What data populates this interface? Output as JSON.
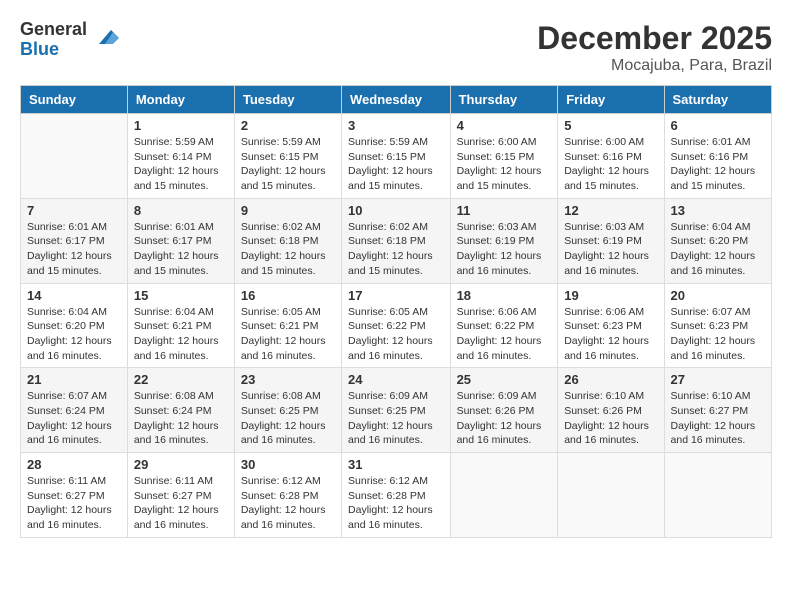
{
  "logo": {
    "general": "General",
    "blue": "Blue"
  },
  "title": "December 2025",
  "location": "Mocajuba, Para, Brazil",
  "weekdays": [
    "Sunday",
    "Monday",
    "Tuesday",
    "Wednesday",
    "Thursday",
    "Friday",
    "Saturday"
  ],
  "weeks": [
    [
      {
        "day": "",
        "info": ""
      },
      {
        "day": "1",
        "info": "Sunrise: 5:59 AM\nSunset: 6:14 PM\nDaylight: 12 hours\nand 15 minutes."
      },
      {
        "day": "2",
        "info": "Sunrise: 5:59 AM\nSunset: 6:15 PM\nDaylight: 12 hours\nand 15 minutes."
      },
      {
        "day": "3",
        "info": "Sunrise: 5:59 AM\nSunset: 6:15 PM\nDaylight: 12 hours\nand 15 minutes."
      },
      {
        "day": "4",
        "info": "Sunrise: 6:00 AM\nSunset: 6:15 PM\nDaylight: 12 hours\nand 15 minutes."
      },
      {
        "day": "5",
        "info": "Sunrise: 6:00 AM\nSunset: 6:16 PM\nDaylight: 12 hours\nand 15 minutes."
      },
      {
        "day": "6",
        "info": "Sunrise: 6:01 AM\nSunset: 6:16 PM\nDaylight: 12 hours\nand 15 minutes."
      }
    ],
    [
      {
        "day": "7",
        "info": "Sunrise: 6:01 AM\nSunset: 6:17 PM\nDaylight: 12 hours\nand 15 minutes."
      },
      {
        "day": "8",
        "info": "Sunrise: 6:01 AM\nSunset: 6:17 PM\nDaylight: 12 hours\nand 15 minutes."
      },
      {
        "day": "9",
        "info": "Sunrise: 6:02 AM\nSunset: 6:18 PM\nDaylight: 12 hours\nand 15 minutes."
      },
      {
        "day": "10",
        "info": "Sunrise: 6:02 AM\nSunset: 6:18 PM\nDaylight: 12 hours\nand 15 minutes."
      },
      {
        "day": "11",
        "info": "Sunrise: 6:03 AM\nSunset: 6:19 PM\nDaylight: 12 hours\nand 16 minutes."
      },
      {
        "day": "12",
        "info": "Sunrise: 6:03 AM\nSunset: 6:19 PM\nDaylight: 12 hours\nand 16 minutes."
      },
      {
        "day": "13",
        "info": "Sunrise: 6:04 AM\nSunset: 6:20 PM\nDaylight: 12 hours\nand 16 minutes."
      }
    ],
    [
      {
        "day": "14",
        "info": "Sunrise: 6:04 AM\nSunset: 6:20 PM\nDaylight: 12 hours\nand 16 minutes."
      },
      {
        "day": "15",
        "info": "Sunrise: 6:04 AM\nSunset: 6:21 PM\nDaylight: 12 hours\nand 16 minutes."
      },
      {
        "day": "16",
        "info": "Sunrise: 6:05 AM\nSunset: 6:21 PM\nDaylight: 12 hours\nand 16 minutes."
      },
      {
        "day": "17",
        "info": "Sunrise: 6:05 AM\nSunset: 6:22 PM\nDaylight: 12 hours\nand 16 minutes."
      },
      {
        "day": "18",
        "info": "Sunrise: 6:06 AM\nSunset: 6:22 PM\nDaylight: 12 hours\nand 16 minutes."
      },
      {
        "day": "19",
        "info": "Sunrise: 6:06 AM\nSunset: 6:23 PM\nDaylight: 12 hours\nand 16 minutes."
      },
      {
        "day": "20",
        "info": "Sunrise: 6:07 AM\nSunset: 6:23 PM\nDaylight: 12 hours\nand 16 minutes."
      }
    ],
    [
      {
        "day": "21",
        "info": "Sunrise: 6:07 AM\nSunset: 6:24 PM\nDaylight: 12 hours\nand 16 minutes."
      },
      {
        "day": "22",
        "info": "Sunrise: 6:08 AM\nSunset: 6:24 PM\nDaylight: 12 hours\nand 16 minutes."
      },
      {
        "day": "23",
        "info": "Sunrise: 6:08 AM\nSunset: 6:25 PM\nDaylight: 12 hours\nand 16 minutes."
      },
      {
        "day": "24",
        "info": "Sunrise: 6:09 AM\nSunset: 6:25 PM\nDaylight: 12 hours\nand 16 minutes."
      },
      {
        "day": "25",
        "info": "Sunrise: 6:09 AM\nSunset: 6:26 PM\nDaylight: 12 hours\nand 16 minutes."
      },
      {
        "day": "26",
        "info": "Sunrise: 6:10 AM\nSunset: 6:26 PM\nDaylight: 12 hours\nand 16 minutes."
      },
      {
        "day": "27",
        "info": "Sunrise: 6:10 AM\nSunset: 6:27 PM\nDaylight: 12 hours\nand 16 minutes."
      }
    ],
    [
      {
        "day": "28",
        "info": "Sunrise: 6:11 AM\nSunset: 6:27 PM\nDaylight: 12 hours\nand 16 minutes."
      },
      {
        "day": "29",
        "info": "Sunrise: 6:11 AM\nSunset: 6:27 PM\nDaylight: 12 hours\nand 16 minutes."
      },
      {
        "day": "30",
        "info": "Sunrise: 6:12 AM\nSunset: 6:28 PM\nDaylight: 12 hours\nand 16 minutes."
      },
      {
        "day": "31",
        "info": "Sunrise: 6:12 AM\nSunset: 6:28 PM\nDaylight: 12 hours\nand 16 minutes."
      },
      {
        "day": "",
        "info": ""
      },
      {
        "day": "",
        "info": ""
      },
      {
        "day": "",
        "info": ""
      }
    ]
  ]
}
